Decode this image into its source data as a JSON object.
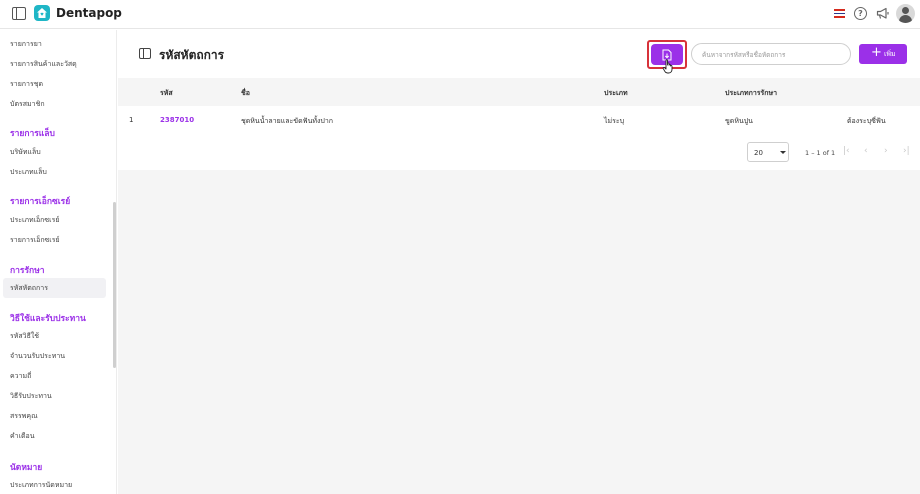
{
  "app": {
    "name": "Dentapop"
  },
  "sidebar": {
    "items_top": [
      "รายการยา",
      "รายการสินค้าและวัสดุ",
      "รายการชุด",
      "บัตรสมาชิก"
    ],
    "section_lab": {
      "heading": "รายการแล็บ",
      "items": [
        "บริษัทแล็บ",
        "ประเภทแล็บ"
      ]
    },
    "section_xray": {
      "heading": "รายการเอ็กซเรย์",
      "items": [
        "ประเภทเอ็กซเรย์",
        "รายการเอ็กซเรย์"
      ]
    },
    "section_treatment": {
      "heading": "การรักษา",
      "items": [
        "รหัสหัตถการ"
      ]
    },
    "section_payment": {
      "heading": "วิธีใช้และรับประทาน",
      "items": [
        "รหัสวิธีใช้",
        "จำนวนรับประทาน",
        "ความถี่",
        "วิธีรับประทาน",
        "สรรพคุณ",
        "คำเตือน"
      ]
    },
    "section_appointment": {
      "heading": "นัดหมาย",
      "items": [
        "ประเภทการนัดหมาย"
      ]
    }
  },
  "page": {
    "title": "รหัสหัตถการ",
    "search_placeholder": "ค้นหาจากรหัสหรือชื่อหัตถการ",
    "add_label": "เพิ่ม",
    "export_icon": "file-export-icon"
  },
  "table": {
    "columns": [
      "รหัส",
      "ชื่อ",
      "ประเภท",
      "ประเภทการรักษา"
    ],
    "rows": [
      {
        "index": "1",
        "code": "2387010",
        "name": "ชุดหินน้ำลายและขัดฟันทั้งปาก",
        "type": "ไม่ระบุ",
        "treatment_type": "ขูดหินปูน",
        "tooth": "ต้องระบุซี่ฟัน"
      }
    ]
  },
  "pagination": {
    "page_size": "20",
    "range": "1 – 1 of 1"
  },
  "colors": {
    "accent": "#9b30e8",
    "highlight_frame": "#d7323a",
    "logo": "#1fb6c6"
  }
}
